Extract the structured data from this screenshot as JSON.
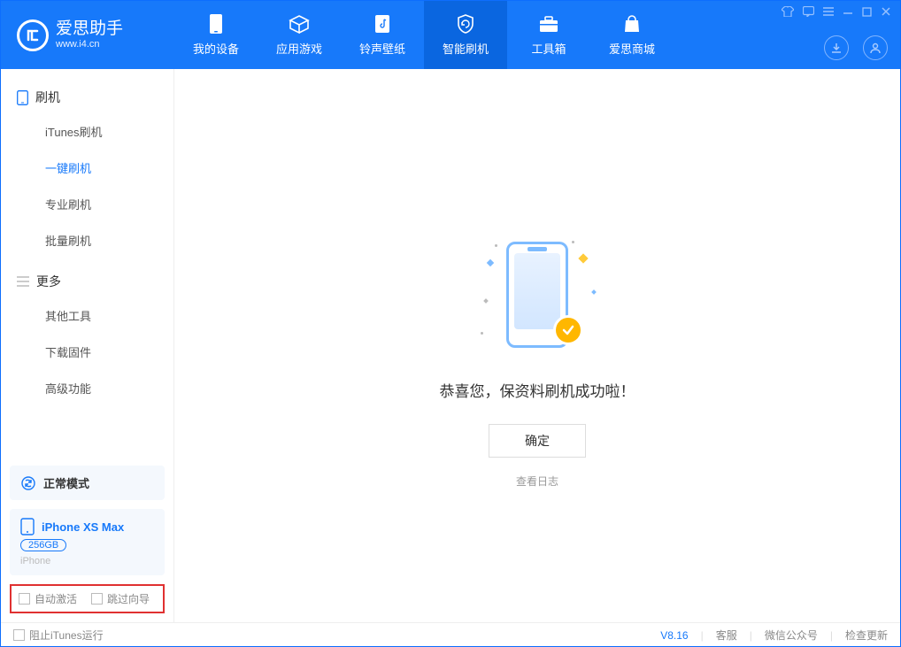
{
  "app": {
    "title": "爱思助手",
    "subtitle": "www.i4.cn"
  },
  "nav": {
    "items": [
      {
        "label": "我的设备"
      },
      {
        "label": "应用游戏"
      },
      {
        "label": "铃声壁纸"
      },
      {
        "label": "智能刷机"
      },
      {
        "label": "工具箱"
      },
      {
        "label": "爱思商城"
      }
    ]
  },
  "sidebar": {
    "group1": "刷机",
    "items1": [
      {
        "label": "iTunes刷机"
      },
      {
        "label": "一键刷机"
      },
      {
        "label": "专业刷机"
      },
      {
        "label": "批量刷机"
      }
    ],
    "group2": "更多",
    "items2": [
      {
        "label": "其他工具"
      },
      {
        "label": "下载固件"
      },
      {
        "label": "高级功能"
      }
    ],
    "mode": "正常模式",
    "device": {
      "name": "iPhone XS Max",
      "storage": "256GB",
      "type": "iPhone"
    },
    "opts": {
      "auto_activate": "自动激活",
      "skip_guide": "跳过向导"
    }
  },
  "main": {
    "success": "恭喜您，保资料刷机成功啦！",
    "ok": "确定",
    "loglink": "查看日志"
  },
  "footer": {
    "block_itunes": "阻止iTunes运行",
    "version": "V8.16",
    "service": "客服",
    "wechat": "微信公众号",
    "update": "检查更新"
  }
}
